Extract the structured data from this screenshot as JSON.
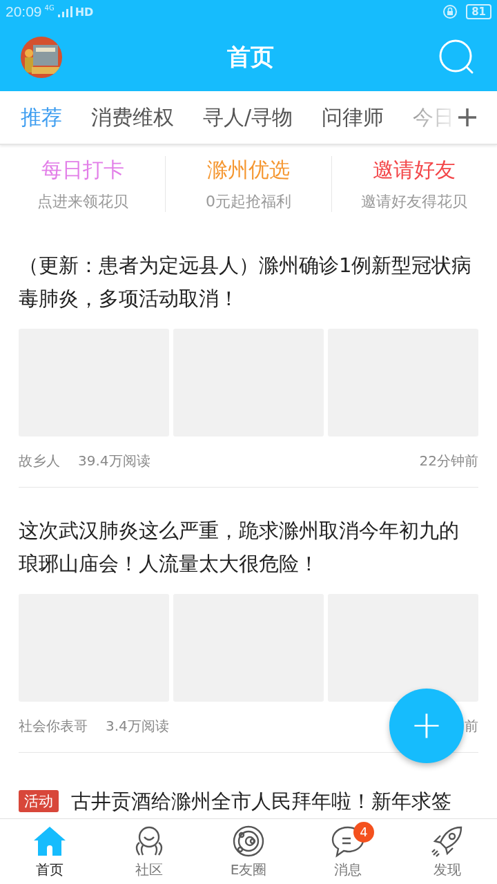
{
  "status_bar": {
    "time": "20:09",
    "network": "4G",
    "hd": "HD",
    "battery": "81"
  },
  "header": {
    "title": "首页"
  },
  "tabs": [
    {
      "label": "推荐",
      "selected": true
    },
    {
      "label": "消费维权",
      "selected": false
    },
    {
      "label": "寻人/寻物",
      "selected": false
    },
    {
      "label": "问律师",
      "selected": false
    },
    {
      "label": "今日",
      "selected": false
    }
  ],
  "shortcuts": [
    {
      "title": "每日打卡",
      "subtitle": "点进来领花贝",
      "color": "#e27ee8"
    },
    {
      "title": "滁州优选",
      "subtitle": "0元起抢福利",
      "color": "#f5962f"
    },
    {
      "title": "邀请好友",
      "subtitle": "邀请好友得花贝",
      "color": "#f3474a"
    }
  ],
  "articles": [
    {
      "title": "（更新：患者为定远县人）滁州确诊1例新型冠状病毒肺炎，多项活动取消！",
      "images": true,
      "author": "故乡人",
      "reads": "39.4万阅读",
      "time": "22分钟前"
    },
    {
      "title": "这次武汉肺炎这么严重，跪求滁州取消今年初九的琅琊山庙会！人流量太大很危险！",
      "images": true,
      "author": "社会你表哥",
      "reads": "3.4万阅读",
      "time": "前"
    },
    {
      "tag": "活动",
      "title": "古井贡酒给滁州全市人民拜年啦！新年求签"
    }
  ],
  "fab": {
    "label": "+"
  },
  "bottom_nav": [
    {
      "label": "首页",
      "selected": true,
      "kind": "home"
    },
    {
      "label": "社区",
      "selected": false,
      "kind": "community"
    },
    {
      "label": "E友圈",
      "selected": false,
      "kind": "planet"
    },
    {
      "label": "消息",
      "selected": false,
      "kind": "chat",
      "badge": "4"
    },
    {
      "label": "发现",
      "selected": false,
      "kind": "rocket"
    }
  ]
}
